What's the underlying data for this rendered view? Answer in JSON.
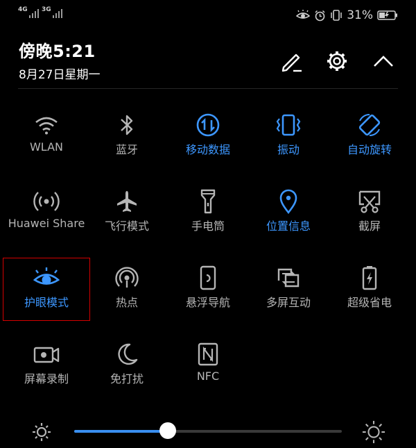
{
  "status_bar": {
    "sim1_network": "4G",
    "sim2_network": "3G",
    "battery_percent": "31%",
    "icons": [
      "eye-comfort-icon",
      "alarm-icon",
      "vibrate-icon",
      "battery-icon"
    ]
  },
  "header": {
    "time": "傍晚5:21",
    "date": "8月27日星期一",
    "actions": [
      "edit-icon",
      "settings-gear-icon",
      "collapse-chevron-icon"
    ]
  },
  "tiles": [
    {
      "label": "WLAN",
      "active": false,
      "icon": "wifi-icon"
    },
    {
      "label": "蓝牙",
      "active": false,
      "icon": "bluetooth-icon"
    },
    {
      "label": "移动数据",
      "active": true,
      "icon": "mobile-data-icon"
    },
    {
      "label": "振动",
      "active": true,
      "icon": "vibrate-icon"
    },
    {
      "label": "自动旋转",
      "active": true,
      "icon": "auto-rotate-icon"
    },
    {
      "label": "Huawei Share",
      "active": false,
      "icon": "huawei-share-icon"
    },
    {
      "label": "飞行模式",
      "active": false,
      "icon": "airplane-icon"
    },
    {
      "label": "手电筒",
      "active": false,
      "icon": "flashlight-icon"
    },
    {
      "label": "位置信息",
      "active": true,
      "icon": "location-pin-icon"
    },
    {
      "label": "截屏",
      "active": false,
      "icon": "screenshot-icon"
    },
    {
      "label": "护眼模式",
      "active": true,
      "icon": "eye-comfort-icon",
      "highlighted": true
    },
    {
      "label": "热点",
      "active": false,
      "icon": "hotspot-icon"
    },
    {
      "label": "悬浮导航",
      "active": false,
      "icon": "floating-dock-icon"
    },
    {
      "label": "多屏互动",
      "active": false,
      "icon": "multi-screen-icon"
    },
    {
      "label": "超级省电",
      "active": false,
      "icon": "power-saving-icon"
    },
    {
      "label": "屏幕录制",
      "active": false,
      "icon": "screen-record-icon"
    },
    {
      "label": "免打扰",
      "active": false,
      "icon": "do-not-disturb-moon-icon"
    },
    {
      "label": "NFC",
      "active": false,
      "icon": "nfc-icon"
    }
  ],
  "brightness": {
    "level": 0.35,
    "min_icon": "brightness-low-icon",
    "max_icon": "brightness-high-icon"
  },
  "colors": {
    "background": "#000000",
    "active_accent": "#3d97ff",
    "inactive_text": "#b5b5b5",
    "highlight_border": "#d40000"
  }
}
